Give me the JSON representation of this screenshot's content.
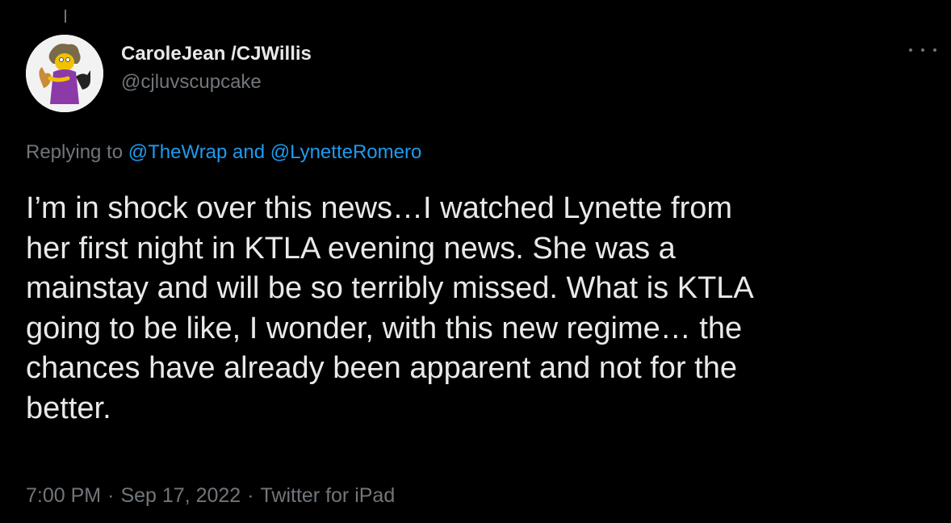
{
  "author": {
    "display_name": "CaroleJean /CJWillis",
    "handle": "@cjluvscupcake",
    "avatar_icon": "cartoon-character-avatar"
  },
  "more_icon": "ellipsis-icon",
  "reply_context": {
    "prefix": "Replying to ",
    "mention_1": "@TheWrap",
    "conjunction": " and ",
    "mention_2": "@LynetteRomero"
  },
  "tweet": {
    "lines": [
      "I’m in shock over this news…I watched Lynette from",
      "her first night in KTLA evening news. She was a",
      "mainstay and will be so terribly missed. What is KTLA",
      "going to be like, I wonder, with this new regime… the",
      "chances have already been apparent and not for the",
      "better."
    ]
  },
  "meta": {
    "time": "7:00 PM",
    "separator": "·",
    "date": "Sep 17, 2022",
    "source": "Twitter for iPad"
  },
  "colors": {
    "background": "#000000",
    "text": "#e7e9ea",
    "secondary": "#71767b",
    "accent": "#1d9bf0"
  }
}
